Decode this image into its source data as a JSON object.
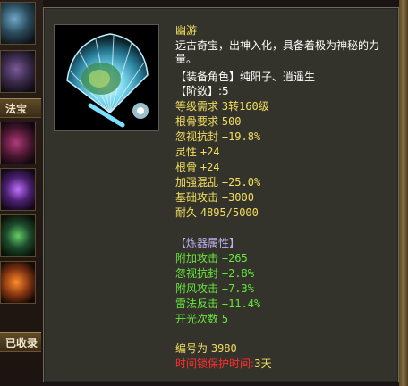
{
  "left_panel": {
    "tab_magic": "法宝",
    "tab_collected": "已收录"
  },
  "tooltip": {
    "item_name": "幽游",
    "description": "远古奇宝，出神入化，具备着极为神秘的力量。",
    "role_label": "【装备角色】",
    "role_value": "纯阳子、逍遥生",
    "tier_label": "【阶数】",
    "tier_value": ":5",
    "stats": [
      {
        "label": "等级需求",
        "value": "3转160级"
      },
      {
        "label": "根骨要求",
        "value": "500"
      },
      {
        "label": "忽视抗封",
        "value": "+19.8%"
      },
      {
        "label": "灵性",
        "value": "+24"
      },
      {
        "label": "根骨",
        "value": "+24"
      },
      {
        "label": "加强混乱",
        "value": "+25.0%"
      },
      {
        "label": "基础攻击",
        "value": "+3000"
      },
      {
        "label": "耐久",
        "value": "4895/5000"
      }
    ],
    "refine_header": "【炼器属性】",
    "refine_stats": [
      {
        "label": "附加攻击",
        "value": "+265"
      },
      {
        "label": "忽视抗封",
        "value": "+2.8%"
      },
      {
        "label": "附风攻击",
        "value": "+7.3%"
      },
      {
        "label": "雷法反击",
        "value": "+11.4%"
      },
      {
        "label": "开光次数",
        "value": "5"
      }
    ],
    "serial_label": "编号为",
    "serial_value": "3980",
    "lock_label": "时间锁保护时间:",
    "lock_value": "3天"
  },
  "colors": {
    "panel_bg": "#33332b",
    "name_yellow": "#f3df5e",
    "refine_green": "#67e63c",
    "header_lavender": "#bcb0f0",
    "lock_red": "#ff2d2d"
  }
}
